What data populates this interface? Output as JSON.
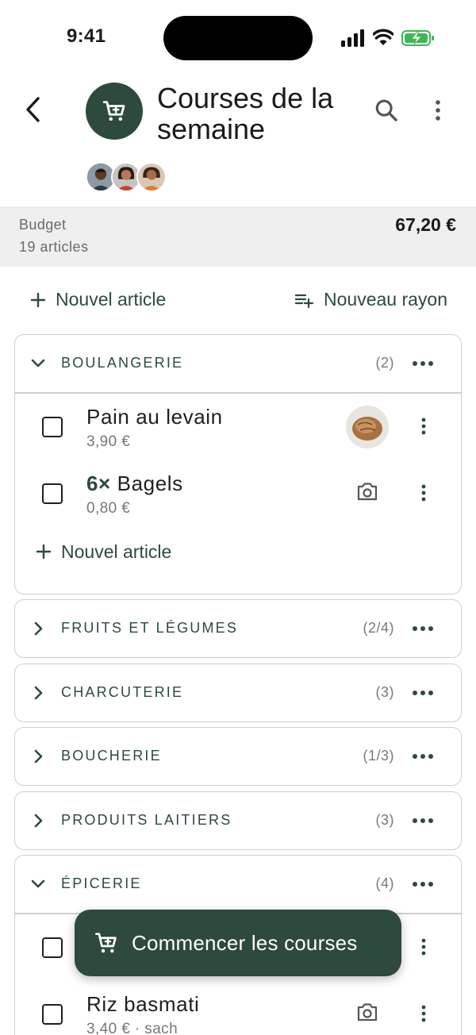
{
  "status_bar": {
    "time": "9:41"
  },
  "header": {
    "title": "Courses de la semaine",
    "icons": {
      "back": "back-arrow-icon",
      "logo": "cart-icon",
      "search": "search-icon",
      "more": "more-vert-icon"
    },
    "colors": {
      "accent": "#2d4a3c"
    }
  },
  "budget": {
    "label": "Budget",
    "count": "19 articles",
    "total": "67,20 €"
  },
  "actions": {
    "new_item": "Nouvel article",
    "new_section": "Nouveau rayon"
  },
  "sections": [
    {
      "name": "BOULANGERIE",
      "count": "(2)",
      "expanded": true,
      "items": [
        {
          "qty": "",
          "name": "Pain au levain",
          "price": "3,90 €",
          "has_photo": true
        },
        {
          "qty": "6×",
          "name": "Bagels",
          "price": "0,80 €",
          "has_photo": false
        }
      ],
      "add_label": "Nouvel article"
    },
    {
      "name": "FRUITS ET LÉGUMES",
      "count": "(2/4)",
      "expanded": false
    },
    {
      "name": "CHARCUTERIE",
      "count": "(3)",
      "expanded": false
    },
    {
      "name": "BOUCHERIE",
      "count": "(1/3)",
      "expanded": false
    },
    {
      "name": "PRODUITS LAITIERS",
      "count": "(3)",
      "expanded": false
    },
    {
      "name": "ÉPICERIE",
      "count": "(4)",
      "expanded": true,
      "items": [
        {
          "qty": "",
          "name": "",
          "price": "",
          "has_photo": false
        },
        {
          "qty": "",
          "name": "Riz basmati",
          "price": "3,40 € · sach",
          "has_photo": false
        }
      ]
    }
  ],
  "fab": {
    "label": "Commencer les courses",
    "icon": "cart-icon"
  }
}
